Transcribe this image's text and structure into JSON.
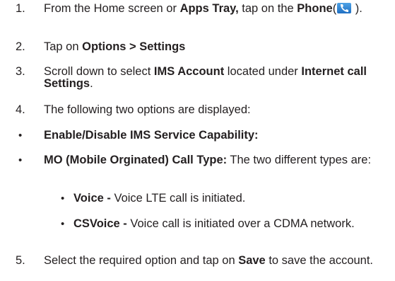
{
  "steps": [
    {
      "num": "1.",
      "pre": "From the Home screen or ",
      "b1": "Apps Tray,",
      "mid": " tap on the ",
      "b2": "Phone",
      "paren_open": "(",
      "paren_close": " )."
    },
    {
      "num": "2.",
      "pre": "Tap on ",
      "b1": "Options > Settings"
    },
    {
      "num": "3.",
      "pre": "Scroll down to select ",
      "b1": "IMS Account",
      "mid": " located under ",
      "b2": "Internet call Settings",
      "end": "."
    },
    {
      "num": "4.",
      "text": "The following two options are displayed:"
    },
    {
      "num": "5.",
      "pre": "Select the required option and tap on ",
      "b1": "Save",
      "end": " to save the account."
    }
  ],
  "bullets": [
    {
      "mark": "•",
      "b1": "Enable/Disable IMS Service Capability:"
    },
    {
      "mark": "•",
      "b1": "MO (Mobile Orginated) Call Type:",
      "rest": " The two different types are:"
    }
  ],
  "sub_bullets": [
    {
      "mark": "•",
      "b1": "Voice -",
      "rest": " Voice LTE call is initiated."
    },
    {
      "mark": "•",
      "b1": "CSVoice -",
      "rest": " Voice call is initiated over a CDMA network."
    }
  ],
  "icons": {
    "phone": "phone-icon"
  },
  "colors": {
    "text": "#231f20",
    "icon": "#1f6fc2"
  }
}
